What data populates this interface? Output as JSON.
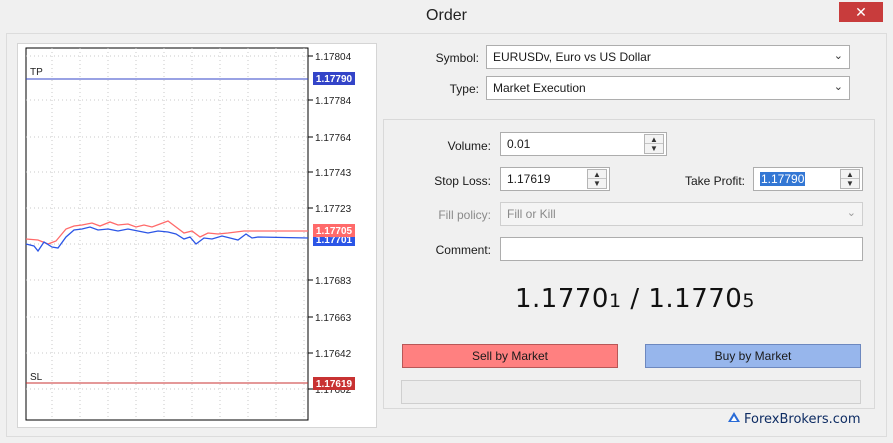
{
  "window": {
    "title": "Order"
  },
  "chart": {
    "price_labels": [
      "1.17804",
      "1.17784",
      "1.17764",
      "1.17743",
      "1.17723",
      "1.17683",
      "1.17663",
      "1.17642",
      "1.17602"
    ],
    "tp_label": "TP",
    "sl_label": "SL",
    "tp_price": "1.17790",
    "sl_price": "1.17619",
    "ask_price": "1.17705",
    "bid_price": "1.17701",
    "colors": {
      "tp": "#3344c8",
      "sl": "#c83232",
      "ask": "#ff6a6a",
      "bid": "#2b55e6"
    }
  },
  "form": {
    "symbol_label": "Symbol:",
    "symbol_value": "EURUSDv, Euro vs US Dollar",
    "type_label": "Type:",
    "type_value": "Market Execution",
    "volume_label": "Volume:",
    "volume_value": "0.01",
    "stop_loss_label": "Stop Loss:",
    "stop_loss_value": "1.17619",
    "take_profit_label": "Take Profit:",
    "take_profit_value": "1.17790",
    "fill_policy_label": "Fill policy:",
    "fill_policy_value": "Fill or Kill",
    "comment_label": "Comment:",
    "comment_value": ""
  },
  "quote": {
    "bid_main": "1.1770",
    "bid_last": "1",
    "separator": " / ",
    "ask_main": "1.1770",
    "ask_last": "5"
  },
  "buttons": {
    "sell": "Sell by Market",
    "buy": "Buy by Market"
  },
  "watermark": "ForexBrokers.com"
}
